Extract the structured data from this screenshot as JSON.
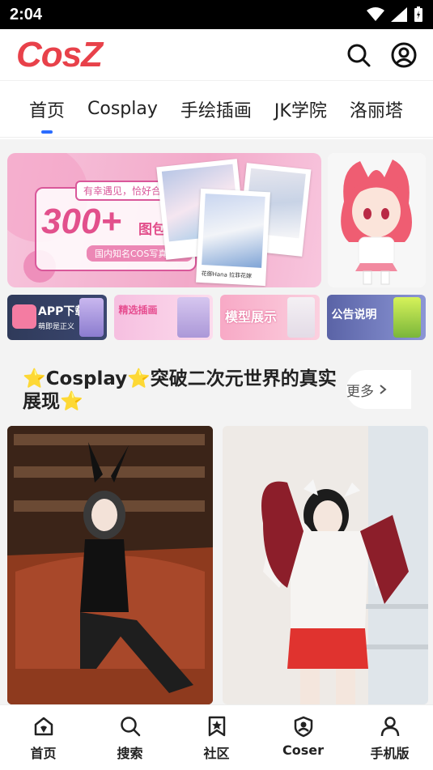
{
  "status_bar": {
    "time": "2:04"
  },
  "header": {
    "logo": "CosZ"
  },
  "tabs": [
    {
      "label": "首页",
      "active": true
    },
    {
      "label": "Cosplay",
      "active": false
    },
    {
      "label": "手绘插画",
      "active": false
    },
    {
      "label": "JK学院",
      "active": false
    },
    {
      "label": "洛丽塔",
      "active": false
    }
  ],
  "banner": {
    "tag": "有幸遇见，恰好合拍",
    "big_text": "300+",
    "sub_text": "图包合集",
    "strip": "国内知名COS写真图集",
    "photo_caption": "花御Hana 拉菲花嫁"
  },
  "mini_banners": [
    {
      "label": "APP下载",
      "sub": "萌即是正义"
    },
    {
      "label": "精选插画",
      "sub": ""
    },
    {
      "label": "模型展示",
      "sub": ""
    },
    {
      "label": "公告说明",
      "sub": ""
    }
  ],
  "section": {
    "title": "⭐Cosplay⭐突破二次元世界的真实展现⭐",
    "more": "更多"
  },
  "bottom_nav": [
    {
      "label": "首页",
      "icon": "home-icon"
    },
    {
      "label": "搜索",
      "icon": "search-icon"
    },
    {
      "label": "社区",
      "icon": "community-icon"
    },
    {
      "label": "Coser",
      "icon": "coser-icon"
    },
    {
      "label": "手机版",
      "icon": "user-icon"
    }
  ],
  "colors": {
    "brand": "#e8414a",
    "accent": "#2b6cff"
  }
}
